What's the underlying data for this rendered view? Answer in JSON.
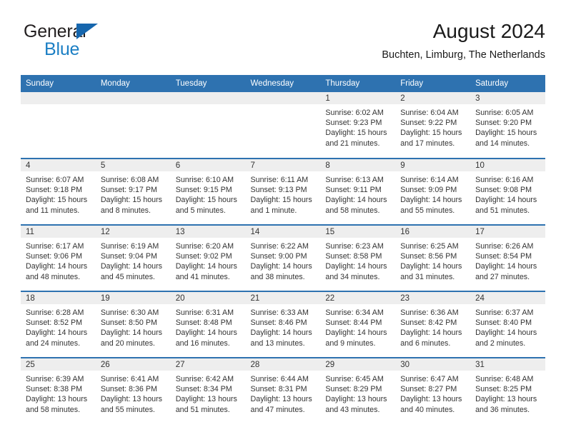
{
  "brand": {
    "word_one": "General",
    "word_two": "Blue",
    "logo_icon": "triangle-logo-icon",
    "accent_color": "#1666ad",
    "blue_text_color": "#1c7fc4"
  },
  "header": {
    "title": "August 2024",
    "subtitle": "Buchten, Limburg, The Netherlands"
  },
  "theme": {
    "header_blue": "#2e72b0",
    "daynum_band": "#eeeeee",
    "text": "#333333"
  },
  "calendar": {
    "weekday_headers": [
      "Sunday",
      "Monday",
      "Tuesday",
      "Wednesday",
      "Thursday",
      "Friday",
      "Saturday"
    ],
    "weeks": [
      [
        {
          "day": "",
          "empty": true
        },
        {
          "day": "",
          "empty": true
        },
        {
          "day": "",
          "empty": true
        },
        {
          "day": "",
          "empty": true
        },
        {
          "day": "1",
          "sunrise": "Sunrise: 6:02 AM",
          "sunset": "Sunset: 9:23 PM",
          "daylight_1": "Daylight: 15 hours",
          "daylight_2": "and 21 minutes."
        },
        {
          "day": "2",
          "sunrise": "Sunrise: 6:04 AM",
          "sunset": "Sunset: 9:22 PM",
          "daylight_1": "Daylight: 15 hours",
          "daylight_2": "and 17 minutes."
        },
        {
          "day": "3",
          "sunrise": "Sunrise: 6:05 AM",
          "sunset": "Sunset: 9:20 PM",
          "daylight_1": "Daylight: 15 hours",
          "daylight_2": "and 14 minutes."
        }
      ],
      [
        {
          "day": "4",
          "sunrise": "Sunrise: 6:07 AM",
          "sunset": "Sunset: 9:18 PM",
          "daylight_1": "Daylight: 15 hours",
          "daylight_2": "and 11 minutes."
        },
        {
          "day": "5",
          "sunrise": "Sunrise: 6:08 AM",
          "sunset": "Sunset: 9:17 PM",
          "daylight_1": "Daylight: 15 hours",
          "daylight_2": "and 8 minutes."
        },
        {
          "day": "6",
          "sunrise": "Sunrise: 6:10 AM",
          "sunset": "Sunset: 9:15 PM",
          "daylight_1": "Daylight: 15 hours",
          "daylight_2": "and 5 minutes."
        },
        {
          "day": "7",
          "sunrise": "Sunrise: 6:11 AM",
          "sunset": "Sunset: 9:13 PM",
          "daylight_1": "Daylight: 15 hours",
          "daylight_2": "and 1 minute."
        },
        {
          "day": "8",
          "sunrise": "Sunrise: 6:13 AM",
          "sunset": "Sunset: 9:11 PM",
          "daylight_1": "Daylight: 14 hours",
          "daylight_2": "and 58 minutes."
        },
        {
          "day": "9",
          "sunrise": "Sunrise: 6:14 AM",
          "sunset": "Sunset: 9:09 PM",
          "daylight_1": "Daylight: 14 hours",
          "daylight_2": "and 55 minutes."
        },
        {
          "day": "10",
          "sunrise": "Sunrise: 6:16 AM",
          "sunset": "Sunset: 9:08 PM",
          "daylight_1": "Daylight: 14 hours",
          "daylight_2": "and 51 minutes."
        }
      ],
      [
        {
          "day": "11",
          "sunrise": "Sunrise: 6:17 AM",
          "sunset": "Sunset: 9:06 PM",
          "daylight_1": "Daylight: 14 hours",
          "daylight_2": "and 48 minutes."
        },
        {
          "day": "12",
          "sunrise": "Sunrise: 6:19 AM",
          "sunset": "Sunset: 9:04 PM",
          "daylight_1": "Daylight: 14 hours",
          "daylight_2": "and 45 minutes."
        },
        {
          "day": "13",
          "sunrise": "Sunrise: 6:20 AM",
          "sunset": "Sunset: 9:02 PM",
          "daylight_1": "Daylight: 14 hours",
          "daylight_2": "and 41 minutes."
        },
        {
          "day": "14",
          "sunrise": "Sunrise: 6:22 AM",
          "sunset": "Sunset: 9:00 PM",
          "daylight_1": "Daylight: 14 hours",
          "daylight_2": "and 38 minutes."
        },
        {
          "day": "15",
          "sunrise": "Sunrise: 6:23 AM",
          "sunset": "Sunset: 8:58 PM",
          "daylight_1": "Daylight: 14 hours",
          "daylight_2": "and 34 minutes."
        },
        {
          "day": "16",
          "sunrise": "Sunrise: 6:25 AM",
          "sunset": "Sunset: 8:56 PM",
          "daylight_1": "Daylight: 14 hours",
          "daylight_2": "and 31 minutes."
        },
        {
          "day": "17",
          "sunrise": "Sunrise: 6:26 AM",
          "sunset": "Sunset: 8:54 PM",
          "daylight_1": "Daylight: 14 hours",
          "daylight_2": "and 27 minutes."
        }
      ],
      [
        {
          "day": "18",
          "sunrise": "Sunrise: 6:28 AM",
          "sunset": "Sunset: 8:52 PM",
          "daylight_1": "Daylight: 14 hours",
          "daylight_2": "and 24 minutes."
        },
        {
          "day": "19",
          "sunrise": "Sunrise: 6:30 AM",
          "sunset": "Sunset: 8:50 PM",
          "daylight_1": "Daylight: 14 hours",
          "daylight_2": "and 20 minutes."
        },
        {
          "day": "20",
          "sunrise": "Sunrise: 6:31 AM",
          "sunset": "Sunset: 8:48 PM",
          "daylight_1": "Daylight: 14 hours",
          "daylight_2": "and 16 minutes."
        },
        {
          "day": "21",
          "sunrise": "Sunrise: 6:33 AM",
          "sunset": "Sunset: 8:46 PM",
          "daylight_1": "Daylight: 14 hours",
          "daylight_2": "and 13 minutes."
        },
        {
          "day": "22",
          "sunrise": "Sunrise: 6:34 AM",
          "sunset": "Sunset: 8:44 PM",
          "daylight_1": "Daylight: 14 hours",
          "daylight_2": "and 9 minutes."
        },
        {
          "day": "23",
          "sunrise": "Sunrise: 6:36 AM",
          "sunset": "Sunset: 8:42 PM",
          "daylight_1": "Daylight: 14 hours",
          "daylight_2": "and 6 minutes."
        },
        {
          "day": "24",
          "sunrise": "Sunrise: 6:37 AM",
          "sunset": "Sunset: 8:40 PM",
          "daylight_1": "Daylight: 14 hours",
          "daylight_2": "and 2 minutes."
        }
      ],
      [
        {
          "day": "25",
          "sunrise": "Sunrise: 6:39 AM",
          "sunset": "Sunset: 8:38 PM",
          "daylight_1": "Daylight: 13 hours",
          "daylight_2": "and 58 minutes."
        },
        {
          "day": "26",
          "sunrise": "Sunrise: 6:41 AM",
          "sunset": "Sunset: 8:36 PM",
          "daylight_1": "Daylight: 13 hours",
          "daylight_2": "and 55 minutes."
        },
        {
          "day": "27",
          "sunrise": "Sunrise: 6:42 AM",
          "sunset": "Sunset: 8:34 PM",
          "daylight_1": "Daylight: 13 hours",
          "daylight_2": "and 51 minutes."
        },
        {
          "day": "28",
          "sunrise": "Sunrise: 6:44 AM",
          "sunset": "Sunset: 8:31 PM",
          "daylight_1": "Daylight: 13 hours",
          "daylight_2": "and 47 minutes."
        },
        {
          "day": "29",
          "sunrise": "Sunrise: 6:45 AM",
          "sunset": "Sunset: 8:29 PM",
          "daylight_1": "Daylight: 13 hours",
          "daylight_2": "and 43 minutes."
        },
        {
          "day": "30",
          "sunrise": "Sunrise: 6:47 AM",
          "sunset": "Sunset: 8:27 PM",
          "daylight_1": "Daylight: 13 hours",
          "daylight_2": "and 40 minutes."
        },
        {
          "day": "31",
          "sunrise": "Sunrise: 6:48 AM",
          "sunset": "Sunset: 8:25 PM",
          "daylight_1": "Daylight: 13 hours",
          "daylight_2": "and 36 minutes."
        }
      ]
    ]
  }
}
